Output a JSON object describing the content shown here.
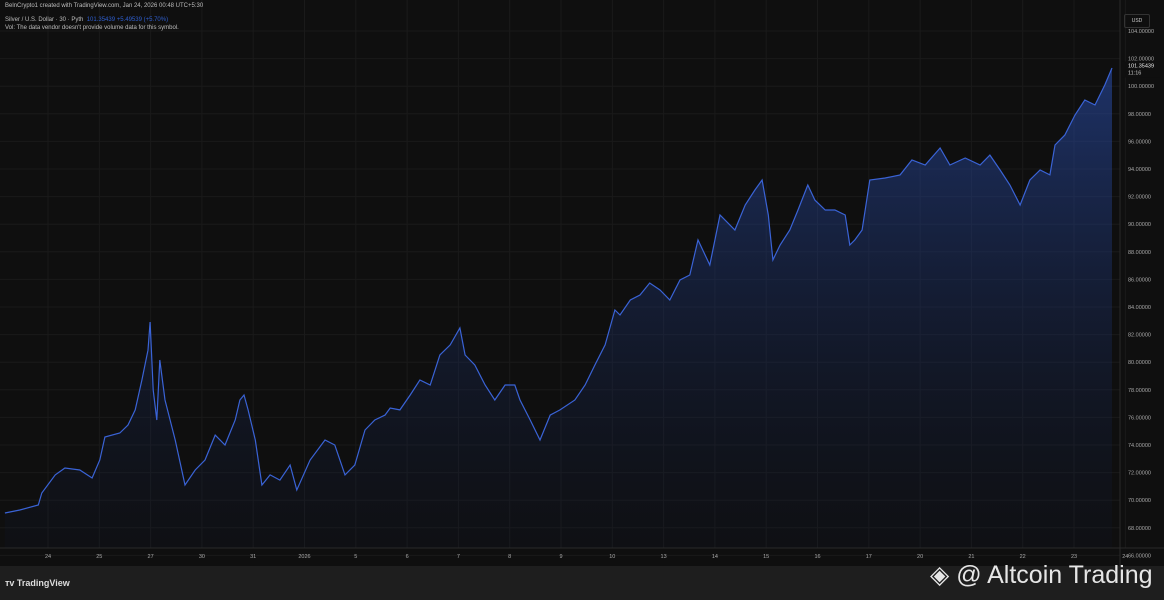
{
  "header": {
    "attribution": "BelnCrypto1 created with TradingView.com, Jan 24, 2026 00:48 UTC+5:30",
    "symbol": "Silver / U.S. Dollar · 30 · Pyth",
    "quote": "101.35439 +5.49539 (+5.70%)",
    "volume_note": "Vol: The data vendor doesn't provide volume data for this symbol."
  },
  "footer": {
    "brand": "TradingView",
    "watermark": "@ Altcoin Trading"
  },
  "colors": {
    "line": "#3a63d6",
    "background": "#0f0f0f"
  },
  "chart_data": {
    "type": "area",
    "title": "Silver / U.S. Dollar · 30 · Pyth",
    "currency": "USD",
    "ylim": [
      66,
      104
    ],
    "yticks": [
      "104.00000",
      "102.00000",
      "100.00000",
      "98.00000",
      "96.00000",
      "94.00000",
      "92.00000",
      "90.00000",
      "88.00000",
      "86.00000",
      "84.00000",
      "82.00000",
      "80.00000",
      "78.00000",
      "76.00000",
      "74.00000",
      "72.00000",
      "70.00000",
      "68.00000",
      "66.00000"
    ],
    "xtick_labels": [
      "24",
      "25",
      "27",
      "30",
      "31",
      "2026",
      "5",
      "6",
      "7",
      "8",
      "9",
      "10",
      "13",
      "14",
      "15",
      "16",
      "17",
      "20",
      "21",
      "22",
      "23",
      "24"
    ],
    "last_price": "101.35439",
    "last_price_countdown": "11:16",
    "x": [
      -0.84,
      -0.55,
      -0.19,
      -0.12,
      0.14,
      0.33,
      0.62,
      0.86,
      1.01,
      1.11,
      1.4,
      1.56,
      1.7,
      1.83,
      1.95,
      1.99,
      2.05,
      2.12,
      2.18,
      2.28,
      2.38,
      2.48,
      2.67,
      2.87,
      3.06,
      3.26,
      3.45,
      3.65,
      3.74,
      3.82,
      3.9,
      4.04,
      4.17,
      4.33,
      4.52,
      4.72,
      4.85,
      5.11,
      5.4,
      5.59,
      5.79,
      5.98,
      6.18,
      6.37,
      6.57,
      6.67,
      6.86,
      7.06,
      7.25,
      7.45,
      7.64,
      7.84,
      8.03,
      8.13,
      8.32,
      8.52,
      8.71,
      8.91,
      9.1,
      9.2,
      9.4,
      9.59,
      9.79,
      9.98,
      10.27,
      10.47,
      10.66,
      10.86,
      11.05,
      11.15,
      11.35,
      11.54,
      11.73,
      11.93,
      12.12,
      12.32,
      12.51,
      12.67,
      12.9,
      13.1,
      13.39,
      13.59,
      13.78,
      13.92,
      14.04,
      14.13,
      14.27,
      14.46,
      14.62,
      14.81,
      14.95,
      15.15,
      15.34,
      15.54,
      15.63,
      15.73,
      15.87,
      16.02,
      16.32,
      16.61,
      16.84,
      17.1,
      17.39,
      17.58,
      17.88,
      18.17,
      18.36,
      18.56,
      18.75,
      18.95,
      19.14,
      19.34,
      19.53,
      19.63,
      19.82,
      20.02,
      20.21,
      20.41,
      20.6,
      20.74
    ],
    "y": [
      69.07,
      69.29,
      69.65,
      70.52,
      71.83,
      72.33,
      72.19,
      71.61,
      72.91,
      74.58,
      74.87,
      75.45,
      76.54,
      78.71,
      80.88,
      82.91,
      77.99,
      75.81,
      80.16,
      77.26,
      75.81,
      74.36,
      71.1,
      72.19,
      72.91,
      74.72,
      74.0,
      75.81,
      77.26,
      77.62,
      76.54,
      74.36,
      71.1,
      71.83,
      71.46,
      72.55,
      70.74,
      72.91,
      74.36,
      74.0,
      71.83,
      72.55,
      75.09,
      75.81,
      76.17,
      76.68,
      76.54,
      77.62,
      78.71,
      78.35,
      80.52,
      81.25,
      82.48,
      80.52,
      79.8,
      78.35,
      77.26,
      78.35,
      78.35,
      77.26,
      75.81,
      74.36,
      76.17,
      76.54,
      77.26,
      78.35,
      79.8,
      81.25,
      83.78,
      83.42,
      84.51,
      84.87,
      85.74,
      85.23,
      84.51,
      85.96,
      86.32,
      88.86,
      87.04,
      90.67,
      89.58,
      91.39,
      92.48,
      93.2,
      90.67,
      87.41,
      88.49,
      89.58,
      91.03,
      92.84,
      91.75,
      91.03,
      91.03,
      90.67,
      88.49,
      88.86,
      89.58,
      93.2,
      93.35,
      93.57,
      94.65,
      94.29,
      95.52,
      94.29,
      94.8,
      94.29,
      95.01,
      93.93,
      92.84,
      91.39,
      93.2,
      93.93,
      93.57,
      95.74,
      96.46,
      97.91,
      99.0,
      98.64,
      100.09,
      101.32
    ]
  }
}
